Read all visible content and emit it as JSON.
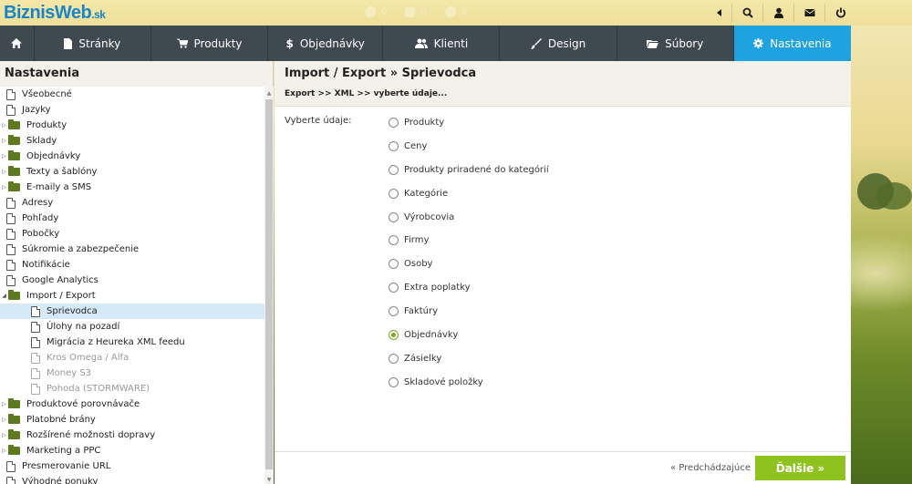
{
  "app": {
    "logo_biznis": "Biznis",
    "logo_web": "Web",
    "logo_sk": ".sk"
  },
  "counters": [
    {
      "icon": "bell-icon",
      "value": "0"
    },
    {
      "icon": "cart-icon",
      "value": "0"
    },
    {
      "icon": "status-icon",
      "value": "0"
    }
  ],
  "top_icons": [
    "back-arrow-icon",
    "search-icon",
    "user-icon",
    "mail-icon",
    "power-icon"
  ],
  "nav": {
    "home_icon": "home-icon",
    "items": [
      {
        "label": "Stránky",
        "icon": "page-icon",
        "active": false
      },
      {
        "label": "Produkty",
        "icon": "cart-icon",
        "active": false
      },
      {
        "label": "Objednávky",
        "icon": "dollar-icon",
        "active": false
      },
      {
        "label": "Klienti",
        "icon": "users-icon",
        "active": false
      },
      {
        "label": "Design",
        "icon": "brush-icon",
        "active": false
      },
      {
        "label": "Súbory",
        "icon": "folder-icon",
        "active": false
      },
      {
        "label": "Nastavenia",
        "icon": "gear-icon",
        "active": true
      }
    ]
  },
  "sidebar": {
    "title": "Nastavenia",
    "items": [
      {
        "label": "Všeobecné",
        "type": "doc",
        "level": 0
      },
      {
        "label": "Jazyky",
        "type": "doc",
        "level": 0
      },
      {
        "label": "Produkty",
        "type": "folder",
        "level": 0,
        "expanded": false
      },
      {
        "label": "Sklady",
        "type": "folder",
        "level": 0,
        "expanded": false
      },
      {
        "label": "Objednávky",
        "type": "folder",
        "level": 0,
        "expanded": false
      },
      {
        "label": "Texty a šablóny",
        "type": "folder",
        "level": 0,
        "expanded": false
      },
      {
        "label": "E-maily a SMS",
        "type": "folder",
        "level": 0,
        "expanded": false
      },
      {
        "label": "Adresy",
        "type": "doc",
        "level": 0
      },
      {
        "label": "Pohľady",
        "type": "doc",
        "level": 0
      },
      {
        "label": "Pobočky",
        "type": "doc",
        "level": 0
      },
      {
        "label": "Súkromie a zabezpečenie",
        "type": "doc",
        "level": 0
      },
      {
        "label": "Notifikácie",
        "type": "doc",
        "level": 0
      },
      {
        "label": "Google Analytics",
        "type": "doc",
        "level": 0
      },
      {
        "label": "Import / Export",
        "type": "folder",
        "level": 0,
        "expanded": true
      },
      {
        "label": "Sprievodca",
        "type": "doc",
        "level": 1,
        "selected": true
      },
      {
        "label": "Úlohy na pozadí",
        "type": "doc",
        "level": 1
      },
      {
        "label": "Migrácia z Heureka XML feedu",
        "type": "doc",
        "level": 1
      },
      {
        "label": "Kros Omega / Alfa",
        "type": "doc",
        "level": 1,
        "disabled": true
      },
      {
        "label": "Money S3",
        "type": "doc",
        "level": 1,
        "disabled": true
      },
      {
        "label": "Pohoda (STORMWARE)",
        "type": "doc",
        "level": 1,
        "disabled": true
      },
      {
        "label": "Produktové porovnávače",
        "type": "folder",
        "level": 0,
        "expanded": false
      },
      {
        "label": "Platobné brány",
        "type": "folder",
        "level": 0,
        "expanded": false
      },
      {
        "label": "Rozšírené možnosti dopravy",
        "type": "folder",
        "level": 0,
        "expanded": false
      },
      {
        "label": "Marketing a PPC",
        "type": "folder",
        "level": 0,
        "expanded": false
      },
      {
        "label": "Presmerovanie URL",
        "type": "doc",
        "level": 0
      },
      {
        "label": "Výhodné ponuky",
        "type": "doc",
        "level": 0
      }
    ]
  },
  "main": {
    "title": "Import / Export » Sprievodca",
    "breadcrumb": "Export >> XML >> vyberte údaje...",
    "form_label": "Vyberte údaje:",
    "options": [
      {
        "label": "Produkty",
        "checked": false
      },
      {
        "label": "Ceny",
        "checked": false
      },
      {
        "label": "Produkty priradené do kategórií",
        "checked": false
      },
      {
        "label": "Kategórie",
        "checked": false
      },
      {
        "label": "Výrobcovia",
        "checked": false
      },
      {
        "label": "Firmy",
        "checked": false
      },
      {
        "label": "Osoby",
        "checked": false
      },
      {
        "label": "Extra poplatky",
        "checked": false
      },
      {
        "label": "Faktúry",
        "checked": false
      },
      {
        "label": "Objednávky",
        "checked": true
      },
      {
        "label": "Zásielky",
        "checked": false
      },
      {
        "label": "Skladové položky",
        "checked": false
      }
    ],
    "prev_label": "« Predchádzajúce",
    "next_label": "Ďalšie »"
  },
  "colors": {
    "nav_bg": "#3f4a50",
    "nav_active": "#1fa3e0",
    "next_button": "#8dc21f",
    "logo": "#1a84c7"
  }
}
